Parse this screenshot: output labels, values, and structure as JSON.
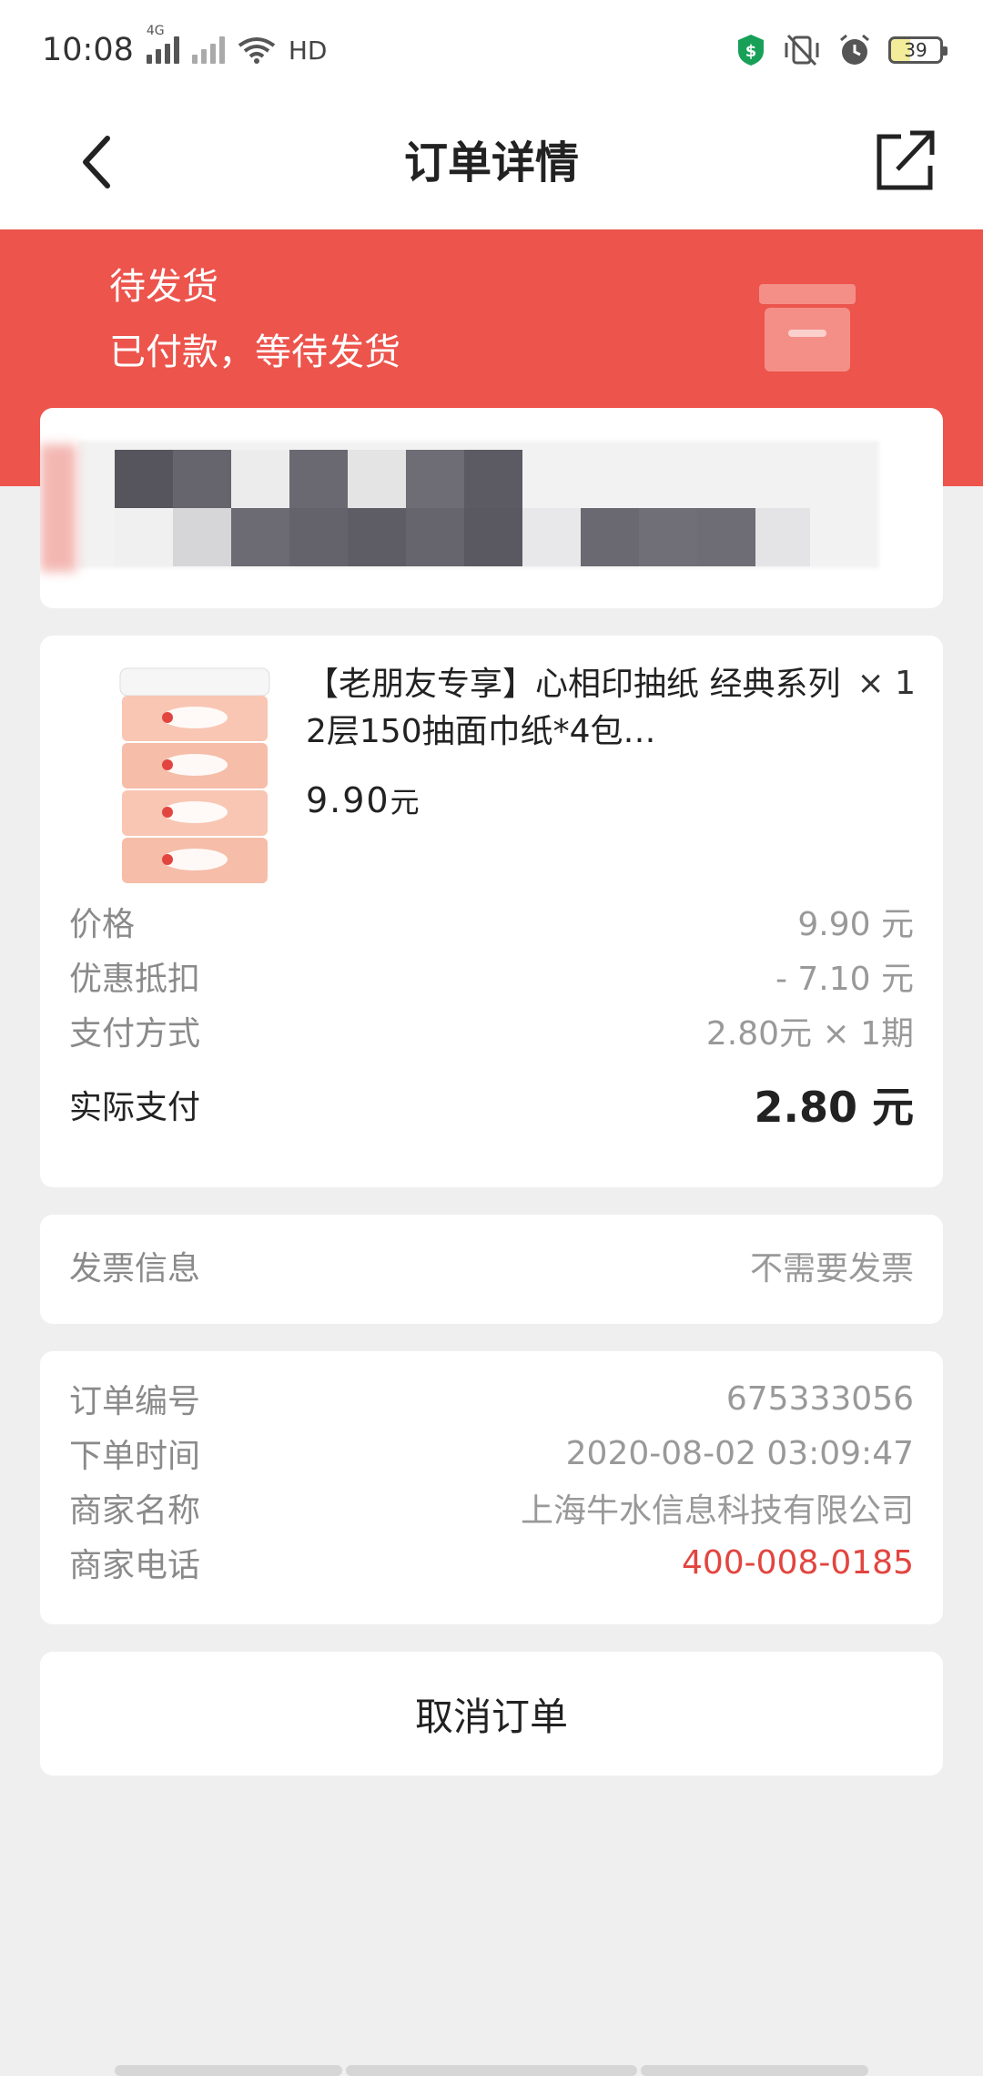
{
  "status_bar": {
    "time": "10:08",
    "net_tag": "4G",
    "hd_label": "HD",
    "battery": "39",
    "icons": [
      "signal-icon",
      "wifi-icon",
      "shield-dollar-icon",
      "mute-vibrate-icon",
      "alarm-icon",
      "battery-icon"
    ]
  },
  "header": {
    "title": "订单详情",
    "back_icon": "chevron-left-icon",
    "share_icon": "share-icon"
  },
  "banner": {
    "status_title": "待发货",
    "status_desc": "已付款，等待发货",
    "icon": "box-icon",
    "color": "#ec544c"
  },
  "goods": {
    "title": "【老朋友专享】心相印抽纸 经典系列 2层150抽面巾纸*4包…",
    "qty": "× 1",
    "price": "9.90",
    "price_unit": "元",
    "rows": [
      {
        "label": "价格",
        "value": "9.90 元"
      },
      {
        "label": "优惠抵扣",
        "value": "- 7.10 元"
      },
      {
        "label": "支付方式",
        "value": "2.80元 × 1期"
      }
    ],
    "actual_label": "实际支付",
    "actual_value": "2.80 元"
  },
  "invoice": {
    "label": "发票信息",
    "value": "不需要发票"
  },
  "info": {
    "rows": [
      {
        "label": "订单编号",
        "value": "675333056"
      },
      {
        "label": "下单时间",
        "value": "2020-08-02 03:09:47"
      },
      {
        "label": "商家名称",
        "value": "上海牛水信息科技有限公司"
      },
      {
        "label": "商家电话",
        "value": "400-008-0185"
      }
    ],
    "phone_color": "#e2453f"
  },
  "actions": {
    "cancel_label": "取消订单"
  }
}
